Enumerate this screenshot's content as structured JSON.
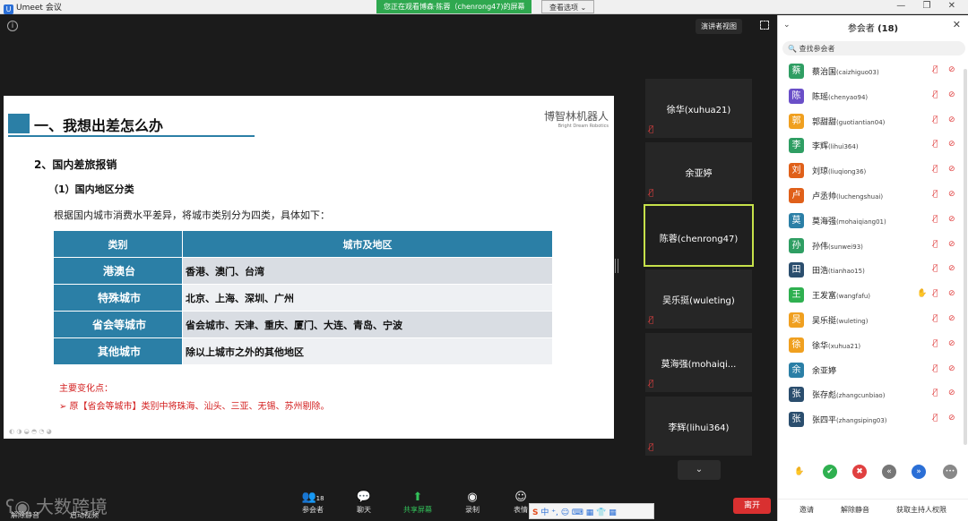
{
  "titlebar": {
    "app_name": "Umeet 会议",
    "logo_letter": "U",
    "share_banner": "您正在观看博森·陈蓉（chenrong47)的屏幕",
    "view_options": "查看选项 ⌄",
    "window_controls": "— ❐ ✕"
  },
  "stage": {
    "info_icon": "i",
    "speaker_view": "演讲者视图",
    "divider": ""
  },
  "slide": {
    "title": "一、我想出差怎么办",
    "brand": "博智林机器人",
    "brand_sub": "Bright Dream Robotics",
    "section": "2、国内差旅报销",
    "subsection": "（1）国内地区分类",
    "intro": "根据国内城市消费水平差异，将城市类别分为四类，具体如下：",
    "table": {
      "headers": [
        "类别",
        "城市及地区"
      ],
      "rows": [
        {
          "category": "港澳台",
          "cities": "香港、澳门、台湾"
        },
        {
          "category": "特殊城市",
          "cities": "北京、上海、深圳、广州"
        },
        {
          "category": "省会等城市",
          "cities": "省会城市、天津、重庆、厦门、大连、青岛、宁波"
        },
        {
          "category": "其他城市",
          "cities": "除以上城市之外的其他地区"
        }
      ]
    },
    "changes_label": "主要变化点：",
    "change_item": "➢ 原【省会等城市】类别中将珠海、汕头、三亚、无锡、苏州剔除。"
  },
  "tiles": [
    {
      "name": "徐华(xuhua21)",
      "active": false
    },
    {
      "name": "余亚婷",
      "active": false
    },
    {
      "name": "陈蓉(chenrong47)",
      "active": true
    },
    {
      "name": "吴乐挺(wuleting)",
      "active": false
    },
    {
      "name": "莫海强(mohaiqi...",
      "active": false
    },
    {
      "name": "李辉(lihui364)",
      "active": false
    }
  ],
  "toolbar": {
    "mute_label": "解除静音",
    "video_label": "启动视频",
    "participants_label": "参会者",
    "participants_count": "18",
    "chat_label": "聊天",
    "share_label": "共享屏幕",
    "record_label": "录制",
    "reactions_label": "表情",
    "leave_label": "离开",
    "ime_text": "中 ⁺, ☺ ⌨ ▦ 👕 ▦",
    "ime_logo": "S",
    "watermark": "大数跨境"
  },
  "panel": {
    "title": "参会者",
    "count": "(18)",
    "search_placeholder": "查找参会者",
    "participants": [
      {
        "initial": "蔡",
        "name": "蔡治国",
        "id": "(caizhiguo03)",
        "color": "#2f9e63",
        "hand": false
      },
      {
        "initial": "陈",
        "name": "陈瑶",
        "id": "(chenyao94)",
        "color": "#6a4fc8",
        "hand": false
      },
      {
        "initial": "郭",
        "name": "郭甜甜",
        "id": "(guotiantian04)",
        "color": "#f0a020",
        "hand": false
      },
      {
        "initial": "李",
        "name": "李辉",
        "id": "(lihui364)",
        "color": "#2f9e63",
        "hand": false
      },
      {
        "initial": "刘",
        "name": "刘琼",
        "id": "(liuqiong36)",
        "color": "#e0601a",
        "hand": false
      },
      {
        "initial": "卢",
        "name": "卢丞帅",
        "id": "(luchengshuai)",
        "color": "#e0601a",
        "hand": false
      },
      {
        "initial": "莫",
        "name": "莫海强",
        "id": "(mohaiqiang01)",
        "color": "#2b7fa6",
        "hand": false
      },
      {
        "initial": "孙",
        "name": "孙伟",
        "id": "(sunwei93)",
        "color": "#2f9e63",
        "hand": false
      },
      {
        "initial": "田",
        "name": "田浩",
        "id": "(tianhao15)",
        "color": "#2b4e6e",
        "hand": false
      },
      {
        "initial": "王",
        "name": "王发富",
        "id": "(wangfafu)",
        "color": "#2fb050",
        "hand": true
      },
      {
        "initial": "吴",
        "name": "吴乐挺",
        "id": "(wuleting)",
        "color": "#f0a020",
        "hand": false
      },
      {
        "initial": "徐",
        "name": "徐华",
        "id": "(xuhua21)",
        "color": "#f0a020",
        "hand": false
      },
      {
        "initial": "余",
        "name": "余亚婷",
        "id": "",
        "color": "#2b7fa6",
        "hand": false
      },
      {
        "initial": "张",
        "name": "张存彪",
        "id": "(zhangcunbiao)",
        "color": "#2b4e6e",
        "hand": false
      },
      {
        "initial": "张",
        "name": "张四平",
        "id": "(zhangsiping03)",
        "color": "#2b4e6e",
        "hand": false
      }
    ],
    "actions": [
      "✋",
      "✔",
      "✖",
      "«",
      "»",
      "•••"
    ],
    "footer": {
      "invite": "邀请",
      "unmute": "解除静音",
      "host": "获取主持人权限"
    }
  }
}
